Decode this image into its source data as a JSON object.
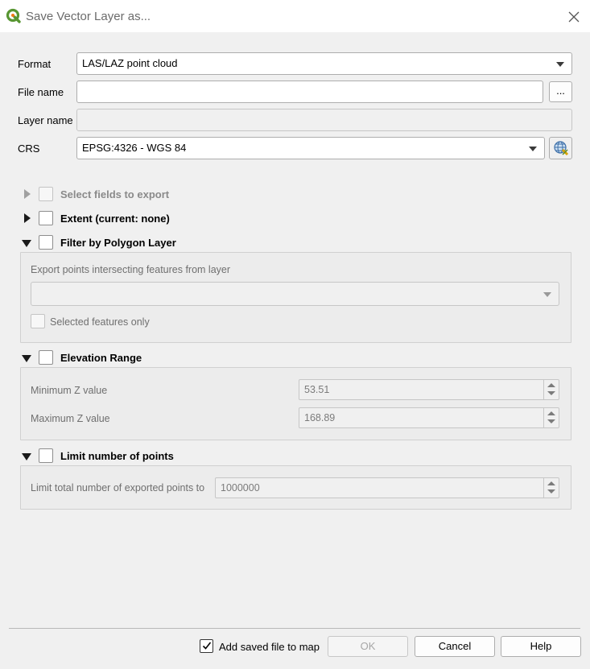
{
  "window": {
    "title": "Save Vector Layer as..."
  },
  "form": {
    "format_label": "Format",
    "format_value": "LAS/LAZ point cloud",
    "filename_label": "File name",
    "filename_value": "",
    "browse_label": "...",
    "layername_label": "Layer name",
    "layername_value": "",
    "crs_label": "CRS",
    "crs_value": "EPSG:4326 - WGS 84"
  },
  "sections": {
    "select_fields": "Select fields to export",
    "extent": "Extent (current: none)",
    "filter_polygon": "Filter by Polygon Layer",
    "elevation": "Elevation Range",
    "limit": "Limit number of points"
  },
  "filter": {
    "label": "Export points intersecting features from layer",
    "layer_value": "",
    "selected_only": "Selected features only"
  },
  "elevation": {
    "min_label": "Minimum Z value",
    "min_value": "53.51",
    "max_label": "Maximum Z value",
    "max_value": "168.89"
  },
  "limit": {
    "label": "Limit total number of exported points to",
    "value": "1000000"
  },
  "footer": {
    "add_to_map": "Add saved file to map",
    "add_to_map_checked": true,
    "ok": "OK",
    "cancel": "Cancel",
    "help": "Help"
  },
  "icons": {
    "app": "qgis-logo-icon",
    "close": "close-icon",
    "crs": "globe-crs-icon"
  },
  "colors": {
    "title_bg": "#ffffff",
    "dialog_bg": "#f0f0f0",
    "qgis_green": "#589632",
    "qgis_yellow": "#ee7913"
  }
}
